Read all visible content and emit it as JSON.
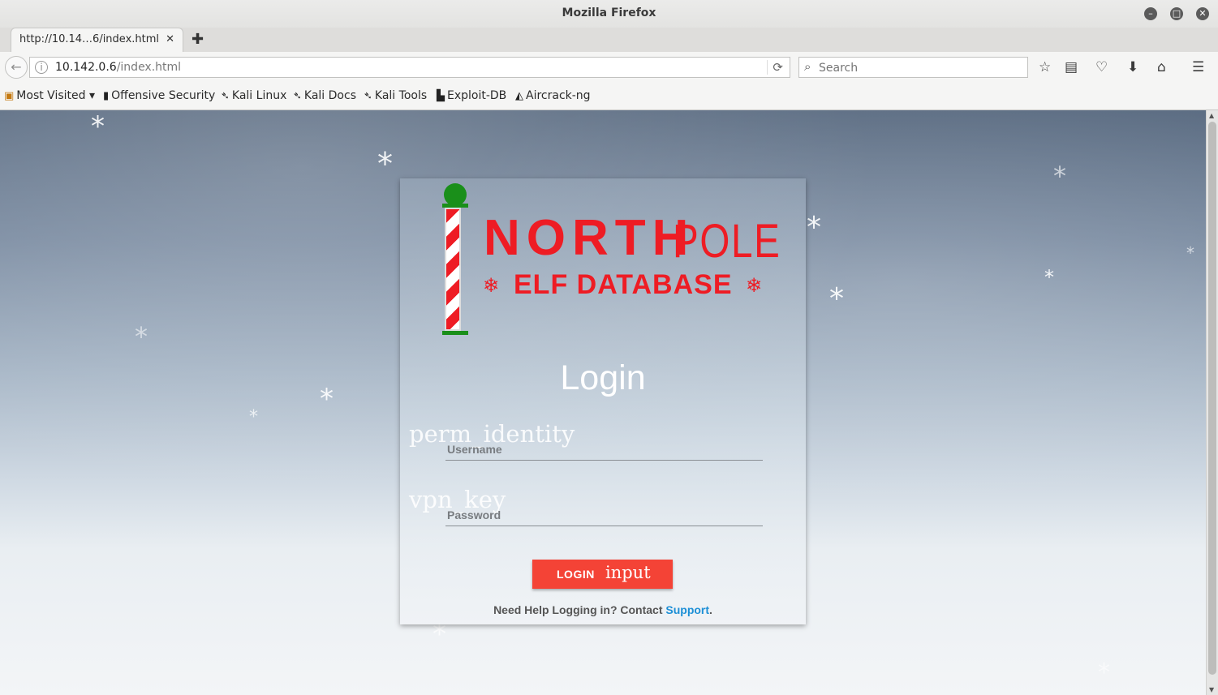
{
  "window": {
    "title": "Mozilla Firefox"
  },
  "tab": {
    "label": "http://10.14…6/index.html"
  },
  "navbar": {
    "url_host": "10.142.0.6",
    "url_path": "/index.html",
    "search_placeholder": "Search"
  },
  "bookmarks": [
    {
      "label": "Most Visited ▾",
      "icon": "folder-icon"
    },
    {
      "label": "Offensive Security",
      "icon": "offsec-icon"
    },
    {
      "label": "Kali Linux",
      "icon": "kali-icon"
    },
    {
      "label": "Kali Docs",
      "icon": "kali-icon"
    },
    {
      "label": "Kali Tools",
      "icon": "kali-icon"
    },
    {
      "label": "Exploit-DB",
      "icon": "exploitdb-icon"
    },
    {
      "label": "Aircrack-ng",
      "icon": "aircrack-icon"
    }
  ],
  "logo": {
    "north": "NORTH",
    "pole": "POLE",
    "subtitle": "ELF DATABASE",
    "snowflake": "❄",
    "colors": {
      "red": "#ee1c24",
      "green": "#1a8f1a"
    }
  },
  "login": {
    "title": "Login",
    "username_icon_text": "perm_identity",
    "username_placeholder": "Username",
    "password_icon_text": "vpn_key",
    "password_placeholder": "Password",
    "button_label": "LOGIN",
    "button_icon_text": "input",
    "button_color": "#f44336",
    "help_text": "Need Help Logging in? Contact ",
    "help_link": "Support",
    "help_end": "."
  }
}
